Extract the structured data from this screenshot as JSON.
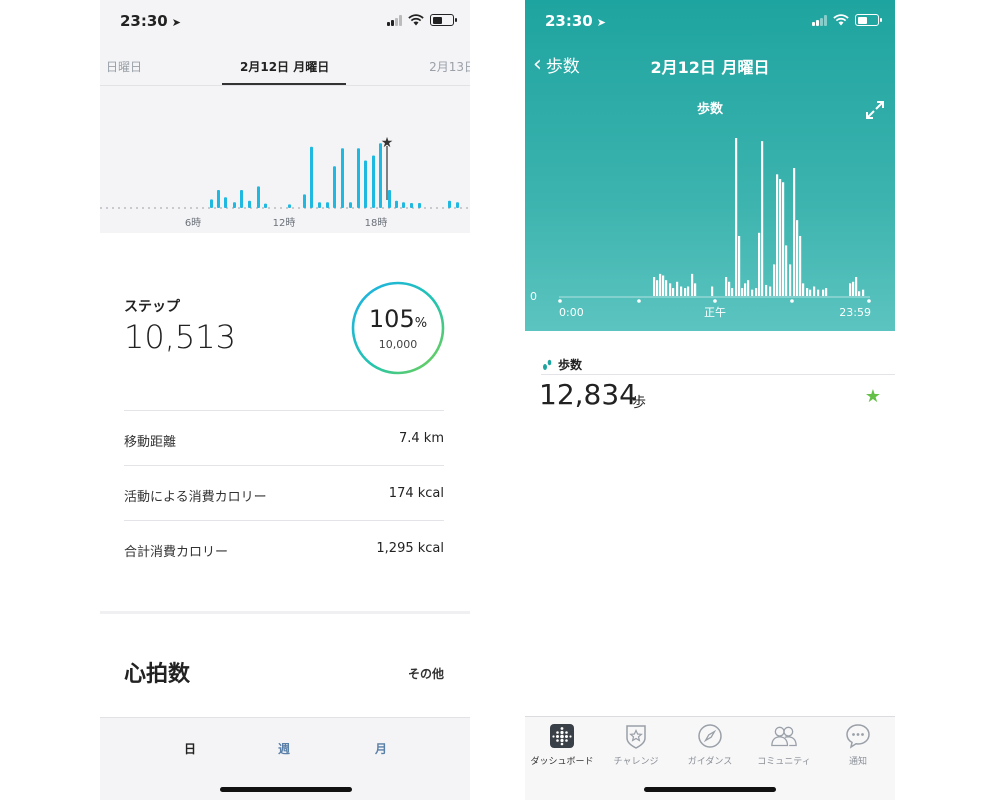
{
  "left": {
    "status": {
      "time": "23:30"
    },
    "date_nav": {
      "prev": "日曜日",
      "current": "2月12日 月曜日",
      "next": "2月13日"
    },
    "chart_data": {
      "type": "bar",
      "x_ticks": [
        "6時",
        "12時",
        "18時"
      ],
      "x_range_hours": [
        0,
        24
      ],
      "goal_marker": "star",
      "values": [
        0,
        0,
        0,
        0,
        0,
        0,
        0,
        0,
        0,
        0,
        0,
        0,
        0,
        0,
        0,
        0,
        0,
        0,
        0,
        0,
        0,
        0,
        0,
        0,
        0,
        0,
        0,
        0,
        0,
        0,
        0,
        0,
        0,
        0,
        0,
        0,
        0,
        0,
        0,
        0,
        0,
        0,
        0,
        0,
        0,
        0,
        0,
        8,
        0,
        0,
        0,
        0,
        0,
        0,
        0,
        0,
        0,
        0,
        0,
        0,
        0,
        0,
        0,
        0,
        0,
        0,
        0,
        0,
        0,
        0,
        0,
        0,
        0,
        0,
        0,
        0,
        0,
        0,
        0,
        0,
        0,
        0,
        0,
        0,
        0,
        0,
        0,
        0,
        0,
        0,
        0,
        0,
        0,
        0,
        0,
        0,
        0,
        0,
        0,
        0,
        0,
        0,
        0,
        0,
        0,
        0,
        0,
        0,
        0,
        0,
        0,
        0,
        0,
        0,
        0,
        0,
        0,
        0,
        0,
        0,
        0,
        0,
        0,
        0,
        0,
        0,
        0,
        0,
        0,
        0,
        0,
        0,
        0,
        0,
        0,
        0,
        0,
        0,
        0,
        0,
        0,
        0,
        0,
        0,
        0,
        0,
        0,
        0
      ]
    },
    "steps": {
      "label": "ステップ",
      "value": "10,513",
      "percent": "105",
      "percent_sign": "%",
      "goal": "10,000",
      "progress": 1.05
    },
    "stats": [
      {
        "label": "移動距離",
        "value": "7.4 km"
      },
      {
        "label": "活動による消費カロリー",
        "value": "174 kcal"
      },
      {
        "label": "合計消費カロリー",
        "value": "1,295 kcal"
      }
    ],
    "heart": {
      "title": "心拍数",
      "other": "その他"
    },
    "tabs": {
      "day": "日",
      "week": "週",
      "month": "月"
    }
  },
  "right": {
    "status": {
      "time": "23:30"
    },
    "nav": {
      "back": "歩数",
      "title": "2月12日 月曜日"
    },
    "chart": {
      "title": "歩数",
      "zero_label": "0",
      "x_labels": {
        "start": "0:00",
        "mid": "正午",
        "end": "23:59"
      }
    },
    "summary": {
      "label": "歩数",
      "value": "12,834",
      "unit": "歩",
      "star": "★"
    },
    "tabs": [
      {
        "label": "ダッシュボード",
        "icon": "dashboard-icon"
      },
      {
        "label": "チャレンジ",
        "icon": "challenge-icon"
      },
      {
        "label": "ガイダンス",
        "icon": "compass-icon"
      },
      {
        "label": "コミュニティ",
        "icon": "community-icon"
      },
      {
        "label": "通知",
        "icon": "chat-bubble-icon"
      }
    ]
  },
  "colors": {
    "teal": "#2aaaa6",
    "bar_blue": "#1fb8e0",
    "star_green": "#65c048",
    "link_blue": "#5a7fa8"
  }
}
